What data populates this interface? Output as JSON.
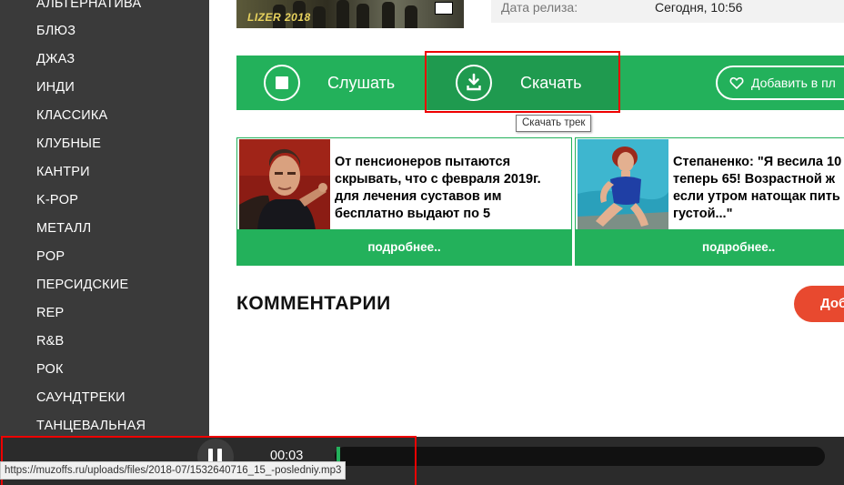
{
  "sidebar": {
    "genres": [
      "АЛЬТЕРНАТИВА",
      "БЛЮЗ",
      "ДЖАЗ",
      "ИНДИ",
      "КЛАССИКА",
      "КЛУБНЫЕ",
      "КАНТРИ",
      "K-POP",
      "МЕТАЛЛ",
      "POP",
      "ПЕРСИДСКИЕ",
      "REP",
      "R&B",
      "РОК",
      "САУНДТРЕКИ",
      "ТАНЦЕВАЛЬНАЯ"
    ]
  },
  "track": {
    "cover_text": "LIZER 2018",
    "release_label": "Дата релиза:",
    "release_value": "Сегодня, 10:56"
  },
  "actions": {
    "listen_label": "Слушать",
    "download_label": "Скачать",
    "add_label": "Добавить в пл",
    "tooltip": "Скачать трек"
  },
  "ads": [
    {
      "lines": [
        "От пенсионеров пытаются",
        "скрывать, что с февраля 2019г.",
        "для лечения суставов им",
        "бесплатно выдают по 5"
      ],
      "more": "подробнее.."
    },
    {
      "lines": [
        "Степаненко: \"Я весила 10",
        "теперь 65! Возрастной ж",
        "если утром натощак пить",
        "густой...\""
      ],
      "more": "подробнее.."
    }
  ],
  "comments": {
    "title": "КОММЕНТАРИИ",
    "add_button": "Доб"
  },
  "player": {
    "time": "00:03",
    "progress": 0.01
  },
  "status": {
    "url": "https://muzoffs.ru/uploads/files/2018-07/1532640716_15_-posledniy.mp3"
  },
  "colors": {
    "green": "#23b15b",
    "green_dark": "#1f9a4f",
    "sidebar": "#3a3a3a",
    "accent_red": "#e8492f"
  }
}
